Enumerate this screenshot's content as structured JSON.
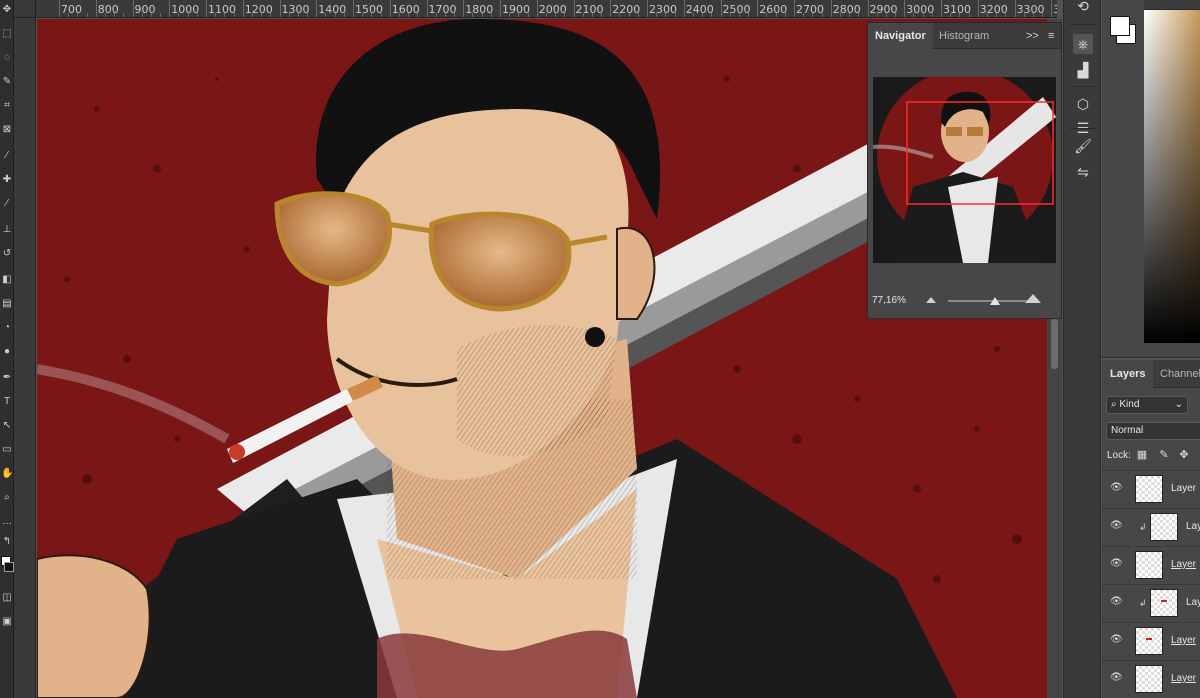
{
  "ruler": {
    "ticks": [
      "700",
      "800",
      "900",
      "1000",
      "1100",
      "1200",
      "1300",
      "1400",
      "1500",
      "1600",
      "1700",
      "1800",
      "1900",
      "2000",
      "2100",
      "2200",
      "2300",
      "2400",
      "2500",
      "2600",
      "2700",
      "2800",
      "2900",
      "3000",
      "3100",
      "3200",
      "3300",
      "3"
    ]
  },
  "navigator": {
    "tabs": [
      "Navigator",
      "Histogram"
    ],
    "active_tab": "Navigator",
    "collapse_glyph": ">>",
    "menu_glyph": "≡",
    "zoom": "77,16%",
    "zoom_fraction": 0.55
  },
  "layers": {
    "tabs": [
      "Layers",
      "Channels"
    ],
    "active_tab": "Layers",
    "filter_label": "Kind",
    "blend_mode": "Normal",
    "lock_label": "Lock:",
    "items": [
      {
        "name": "Layer",
        "clipped": false,
        "underlined": false,
        "thumb": "blank"
      },
      {
        "name": "Lay",
        "clipped": true,
        "underlined": false,
        "thumb": "blank"
      },
      {
        "name": "Layer",
        "clipped": false,
        "underlined": true,
        "thumb": "blank"
      },
      {
        "name": "Lay",
        "clipped": true,
        "underlined": false,
        "thumb": "mark"
      },
      {
        "name": "Layer",
        "clipped": false,
        "underlined": true,
        "thumb": "mark"
      },
      {
        "name": "Layer",
        "clipped": false,
        "underlined": true,
        "thumb": "blank"
      }
    ]
  },
  "colors": {
    "canvas_background": "#7a1616",
    "navigator_frame": "#ff2b2b",
    "ui_panel": "#474747"
  }
}
